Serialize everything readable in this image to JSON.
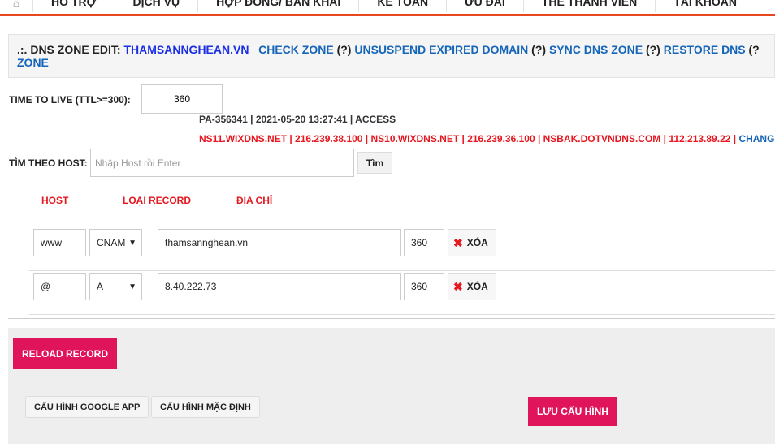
{
  "nav": {
    "home_icon": "home-icon",
    "items": [
      "HỖ TRỢ",
      "DỊCH VỤ",
      "HỢP ĐỒNG/ BẢN KHAI",
      "KẾ TOÁN",
      "ƯU ĐÃI",
      "THẺ THÀNH VIÊN",
      "TÀI KHOẢN"
    ]
  },
  "zone": {
    "prefix": ".:. DNS ZONE EDIT: ",
    "domain": "THAMSANNGHEAN.VN",
    "check": "CHECK ZONE",
    "q": "(?)",
    "unsuspend": "UNSUSPEND EXPIRED DOMAIN",
    "sync": "SYNC DNS ZONE",
    "restore": "RESTORE DNS",
    "tail": "(?",
    "zone_word": "ZONE"
  },
  "ttl": {
    "label": "TIME TO LIVE (TTL>=300):",
    "value": "360"
  },
  "meta": "PA-356341 | 2021-05-20 13:27:41 | ACCESS",
  "nameservers": {
    "text": "NS11.WIXDNS.NET | 216.239.38.100 | NS10.WIXDNS.NET | 216.239.36.100 | NSBAK.DOTVNDNS.COM | 112.213.89.22 | ",
    "change": "CHANG"
  },
  "search": {
    "label": "TÌM THEO HOST:",
    "placeholder": "Nhập Host rồi Enter",
    "button": "Tìm"
  },
  "columns": {
    "host": "HOST",
    "type": "LOẠI RECORD",
    "address": "ĐỊA CHỈ"
  },
  "records": [
    {
      "host": "www",
      "type": "CNAM",
      "address": "thamsannghean.vn",
      "ttl": "360",
      "delete": "XÓA"
    },
    {
      "host": "@",
      "type": "A",
      "address": "8.40.222.73",
      "ttl": "360",
      "delete": "XÓA"
    }
  ],
  "actions": {
    "reload": "RELOAD RECORD",
    "google_app": "CẤU HÌNH GOOGLE APP",
    "default_cfg": "CẤU HÌNH MẶC ĐỊNH",
    "save": "LƯU CẤU HÌNH"
  },
  "colors": {
    "accent": "#e0145a",
    "red_text": "#e8161e",
    "link": "#1565b8"
  }
}
